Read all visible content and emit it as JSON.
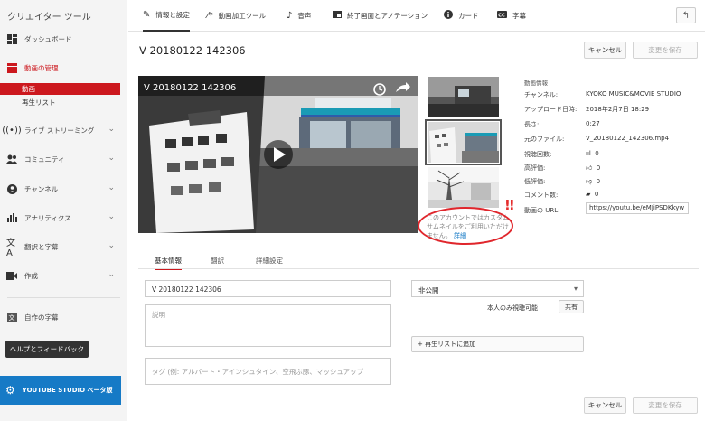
{
  "sidebar": {
    "title": "クリエイター ツール",
    "items": [
      {
        "label": "ダッシュボード",
        "icon": "dashboard-icon"
      },
      {
        "label": "動画の管理",
        "icon": "video-manager-icon",
        "active": true
      },
      {
        "label": "ライブ ストリーミング",
        "icon": "live-icon"
      },
      {
        "label": "コミュニティ",
        "icon": "community-icon"
      },
      {
        "label": "チャンネル",
        "icon": "channel-icon"
      },
      {
        "label": "アナリティクス",
        "icon": "analytics-icon"
      },
      {
        "label": "翻訳と字幕",
        "icon": "translate-icon"
      },
      {
        "label": "作成",
        "icon": "create-icon"
      }
    ],
    "sub_items": [
      "動画",
      "再生リスト"
    ],
    "own_subtitles": "自作の字幕",
    "help_button": "ヘルプとフィードバック",
    "studio_button": "YOUTUBE STUDIO ベータ版",
    "accent_color": "#cc181e",
    "studio_color": "#167ac6"
  },
  "tabs": [
    {
      "label": "情報と設定",
      "icon": "pencil-icon"
    },
    {
      "label": "動画加工ツール",
      "icon": "magic-wand-icon"
    },
    {
      "label": "音声",
      "icon": "music-note-icon"
    },
    {
      "label": "終了画面とアノテーション",
      "icon": "end-screen-icon"
    },
    {
      "label": "カード",
      "icon": "info-card-icon"
    },
    {
      "label": "字幕",
      "icon": "cc-icon"
    }
  ],
  "video": {
    "title": "V 20180122 142306",
    "player_title": "V 20180122 142306"
  },
  "buttons": {
    "cancel": "キャンセル",
    "save": "変更を保存"
  },
  "thumbnail_notice": {
    "text": "このアカウントではカスタム サムネイルをご利用いただけません。",
    "link": "詳細",
    "marks": "!!"
  },
  "video_info": {
    "heading": "動画情報",
    "channel_label": "チャンネル:",
    "channel_value": "KYOKO MUSIC&MOVIE STUDIO",
    "upload_label": "アップロード日時:",
    "upload_value": "2018年2月7日 18:29",
    "length_label": "長さ:",
    "length_value": "0:27",
    "file_label": "元のファイル:",
    "file_value": "V_20180122_142306.mp4",
    "views_label": "視聴回数:",
    "views_value": "0",
    "likes_label": "高評価:",
    "likes_value": "0",
    "dislikes_label": "低評価:",
    "dislikes_value": "0",
    "comments_label": "コメント数:",
    "comments_value": "0",
    "url_label": "動画の URL:",
    "url_value": "https://youtu.be/eMJiPSDKkyw"
  },
  "subtabs": [
    "基本情報",
    "翻訳",
    "詳細設定"
  ],
  "form": {
    "title_value": "V 20180122 142306",
    "description_placeholder": "説明",
    "tags_placeholder": "タグ (例: アルバート・アインシュタイン、空飛ぶ豚、マッシュアップ",
    "privacy_value": "非公開",
    "share_label": "本人のみ視聴可能",
    "share_button": "共有",
    "playlist_button": "+ 再生リストに追加"
  }
}
